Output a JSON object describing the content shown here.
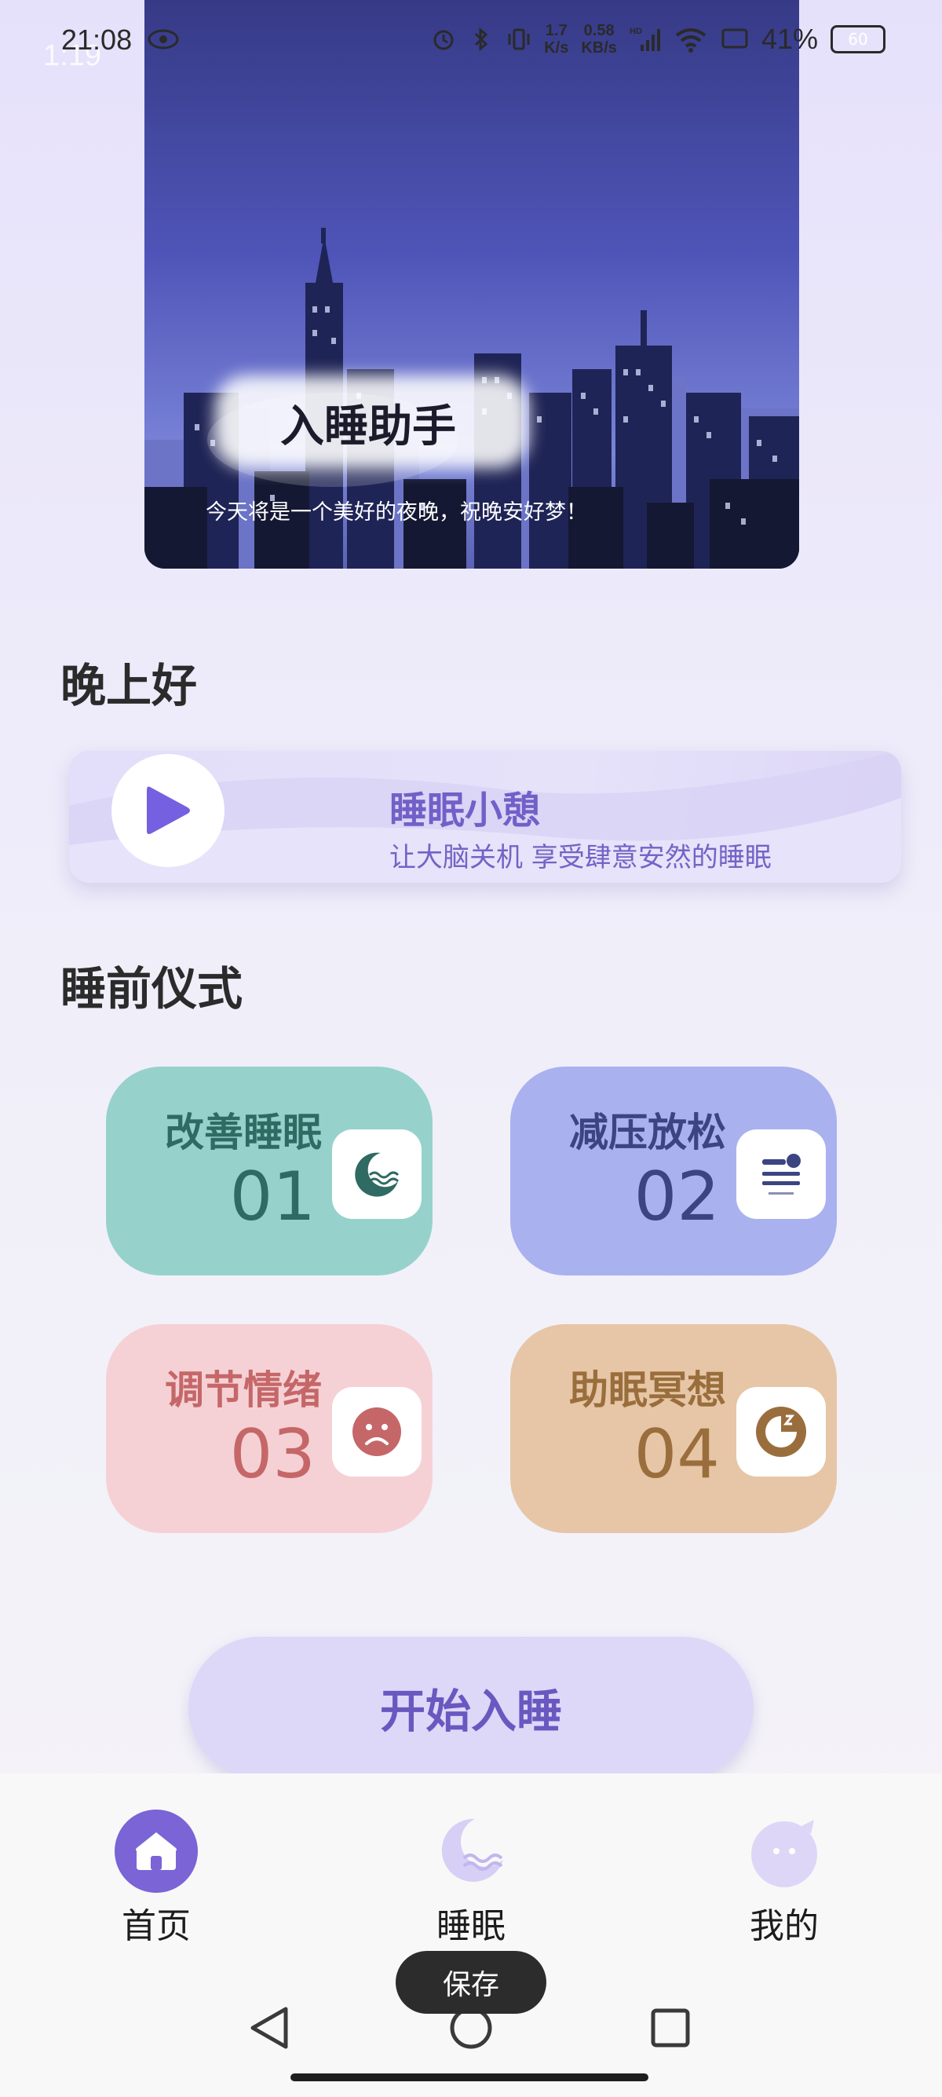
{
  "status_bar": {
    "time": "21:08",
    "time_overlay": "1:19",
    "net_speed_top": "1.7",
    "net_speed_top_unit": "K/s",
    "net_speed": "0.58",
    "net_speed_unit": "KB/s",
    "signal_label": "HD",
    "battery_percent": "41%",
    "battery_box": "60"
  },
  "hero": {
    "title": "入睡助手",
    "subtitle": "今天将是一个美好的夜晚，祝晚安好梦！"
  },
  "greeting": "晚上好",
  "nap_card": {
    "title": "睡眠小憩",
    "subtitle": "让大脑关机 享受肆意安然的睡眠"
  },
  "ritual": {
    "title": "睡前仪式",
    "tiles": [
      {
        "name": "改善睡眠",
        "number": "01",
        "icon": "moon-waves-icon"
      },
      {
        "name": "减压放松",
        "number": "02",
        "icon": "relaxation-icon"
      },
      {
        "name": "调节情绪",
        "number": "03",
        "icon": "sad-face-icon"
      },
      {
        "name": "助眠冥想",
        "number": "04",
        "icon": "sleep-clock-icon"
      }
    ]
  },
  "start_button": "开始入睡",
  "bottom_nav": [
    {
      "label": "首页",
      "icon": "home-icon",
      "active": true
    },
    {
      "label": "睡眠",
      "icon": "moon-icon",
      "active": false
    },
    {
      "label": "我的",
      "icon": "profile-icon",
      "active": false
    }
  ],
  "toast": "保存",
  "colors": {
    "accent": "#7260c8",
    "tile1": "#96d2cb",
    "tile2": "#a9b1ef",
    "tile3": "#f5d1d5",
    "tile4": "#e6c6a6"
  }
}
